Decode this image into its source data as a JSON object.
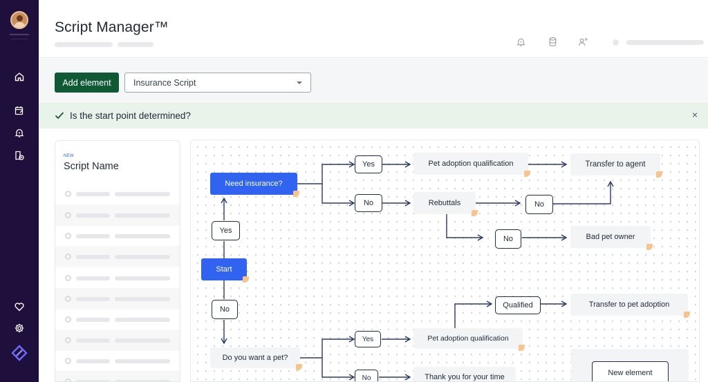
{
  "header": {
    "title": "Script Manager™"
  },
  "toolbar": {
    "add_label": "Add element",
    "script_select": {
      "value": "Insurance Script"
    }
  },
  "alert": {
    "message": "Is the start point determined?",
    "close": "×"
  },
  "panel": {
    "badge": "NEW",
    "title": "Script Name"
  },
  "flow": {
    "need_insurance": "Need insurance?",
    "yes_top": "Yes",
    "no_top": "No",
    "pet_adoption_qualification_top": "Pet adoption qualification",
    "transfer_to_agent": "Transfer to agent",
    "rebuttals": "Rebuttals",
    "no_rebuttal_1": "No",
    "no_rebuttal_2": "No",
    "bad_pet_owner": "Bad pet owner",
    "yes_start": "Yes",
    "start": "Start",
    "no_start": "No",
    "qualified": "Qualified",
    "transfer_to_pet_adoption": "Transfer to pet adoption",
    "do_you_want_a_pet": "Do you want a pet?",
    "yes_bottom": "Yes",
    "pet_adoption_qualification_bottom": "Pet adoption qualification",
    "no_bottom": "No",
    "thank_you": "Thank you for your time",
    "new_element": "New element"
  },
  "colors": {
    "sidebar": "#1e0f3d",
    "primary_button": "#0f5a35",
    "node_blue": "#2f63f0",
    "alert_bg": "#e8f3ea",
    "connector": "#2b3a67"
  }
}
